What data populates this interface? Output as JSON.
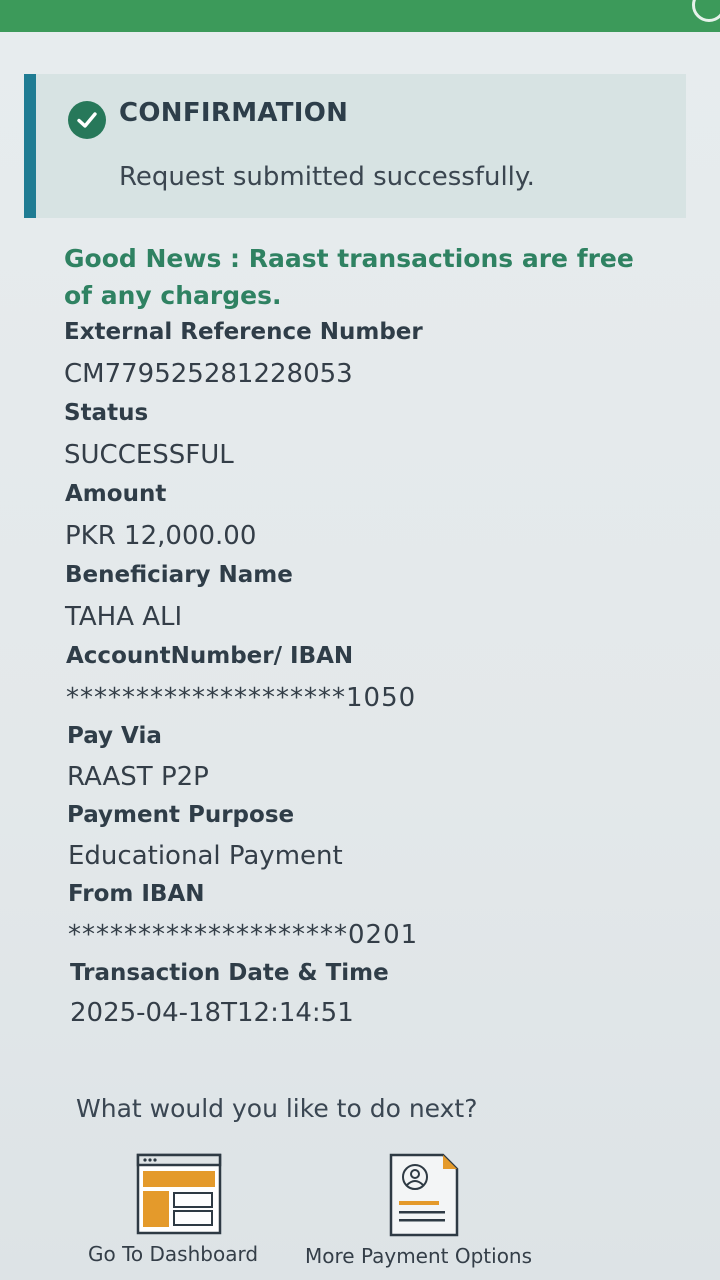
{
  "confirmation": {
    "title": "CONFIRMATION",
    "message": "Request submitted successfully."
  },
  "good_news": "Good News : Raast transactions are free of any charges.",
  "details": [
    {
      "label": "External Reference Number",
      "value": "CM779525281228053"
    },
    {
      "label": "Status",
      "value": "SUCCESSFUL"
    },
    {
      "label": "Amount",
      "value": "PKR 12,000.00"
    },
    {
      "label": "Beneficiary Name",
      "value": "TAHA ALI"
    },
    {
      "label": "AccountNumber/ IBAN",
      "value": "********************1050"
    },
    {
      "label": "Pay Via",
      "value": "RAAST P2P"
    },
    {
      "label": "Payment Purpose",
      "value": "Educational Payment"
    },
    {
      "label": "From IBAN",
      "value": "********************0201"
    },
    {
      "label": "Transaction Date & Time",
      "value": "2025-04-18T12:14:51"
    }
  ],
  "next": {
    "prompt": "What would you like to do next?",
    "actions": [
      {
        "label": "Go To Dashboard",
        "icon": "dashboard-icon"
      },
      {
        "label": "More Payment Options",
        "icon": "payment-document-icon"
      }
    ]
  },
  "colors": {
    "header": "#3c9a5a",
    "accent_bar": "#1f7c93",
    "good_news": "#2f8262",
    "dashboard_orange": "#e49a2b"
  }
}
